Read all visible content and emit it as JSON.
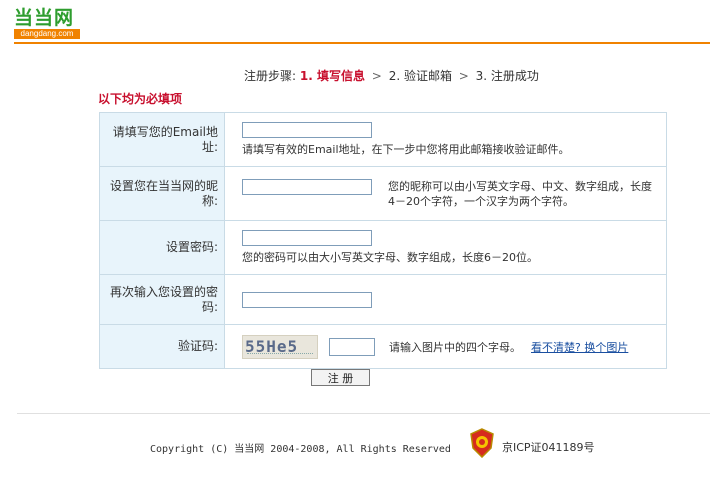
{
  "logo": {
    "main": "当当网",
    "sub": "dangdang.com"
  },
  "steps": {
    "prefix": "注册步骤:",
    "step1": "1. 填写信息",
    "step2": "2. 验证邮箱",
    "step3": "3. 注册成功",
    "arrow": ">"
  },
  "required_note": "以下均为必填项",
  "form": {
    "email": {
      "label": "请填写您的Email地址:",
      "value": "",
      "hint": "请填写有效的Email地址，在下一步中您将用此邮箱接收验证邮件。"
    },
    "nickname": {
      "label": "设置您在当当网的昵称:",
      "value": "",
      "hint": "您的昵称可以由小写英文字母、中文、数字组成，长度4－20个字符，一个汉字为两个字符。"
    },
    "password": {
      "label": "设置密码:",
      "value": "",
      "hint": "您的密码可以由大小写英文字母、数字组成，长度6－20位。"
    },
    "password_confirm": {
      "label": "再次输入您设置的密码:",
      "value": ""
    },
    "captcha": {
      "label": "验证码:",
      "image_text": "55He5",
      "value": "",
      "hint": "请输入图片中的四个字母。",
      "refresh_link": "看不清楚? 换个图片"
    }
  },
  "submit_label": "注 册",
  "footer": {
    "copyright": "Copyright (C) 当当网 2004-2008, All Rights Reserved",
    "icp": "京ICP证041189号"
  },
  "colors": {
    "brand_orange": "#f08200",
    "brand_green": "#2e9d2e",
    "accent_red": "#c8102e",
    "label_bg": "#e8f4fb",
    "link_blue": "#1a4fa0"
  }
}
